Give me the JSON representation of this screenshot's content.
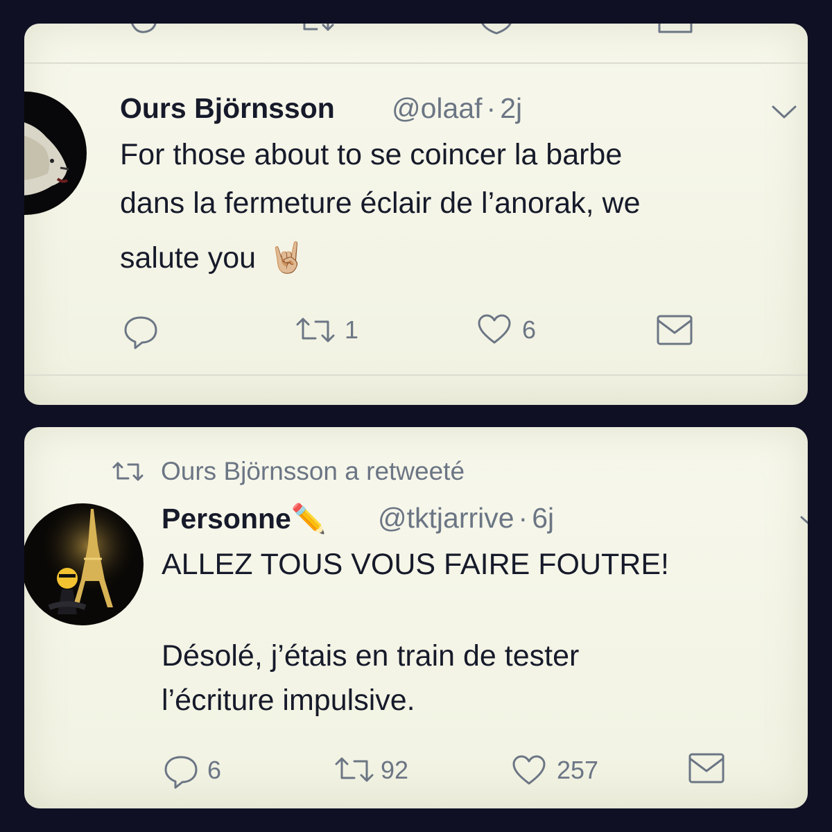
{
  "tweet1": {
    "display_name": "Ours Björnsson",
    "handle": "@olaaf",
    "separator": "·",
    "time": "2j",
    "lines": [
      "For those about to se coincer la barbe",
      "dans la fermeture éclair de l’anorak, we",
      "salute you"
    ],
    "emoji": "🤘🏼",
    "actions": {
      "replies": "",
      "retweets": "1",
      "likes": "6"
    },
    "icons": [
      "reply-icon",
      "retweet-icon",
      "like-icon",
      "dm-icon",
      "chevron-down-icon"
    ]
  },
  "tweet2": {
    "retweet_context": "Ours Björnsson a retweeté",
    "display_name": "Personne",
    "name_emoji": "✏️",
    "handle": "@tktjarrive",
    "separator": "·",
    "time": "6j",
    "lines": [
      "ALLEZ TOUS VOUS FAIRE FOUTRE!",
      "",
      "Désolé, j’étais en train de tester",
      "l’écriture impulsive."
    ],
    "actions": {
      "replies": "6",
      "retweets": "92",
      "likes": "257"
    },
    "icons": [
      "reply-icon",
      "retweet-icon",
      "like-icon",
      "dm-icon",
      "chevron-down-icon"
    ]
  },
  "colors": {
    "frame": "#0f1024",
    "card": "#f5f6e8",
    "text": "#161a2a",
    "muted": "#6b7584"
  }
}
